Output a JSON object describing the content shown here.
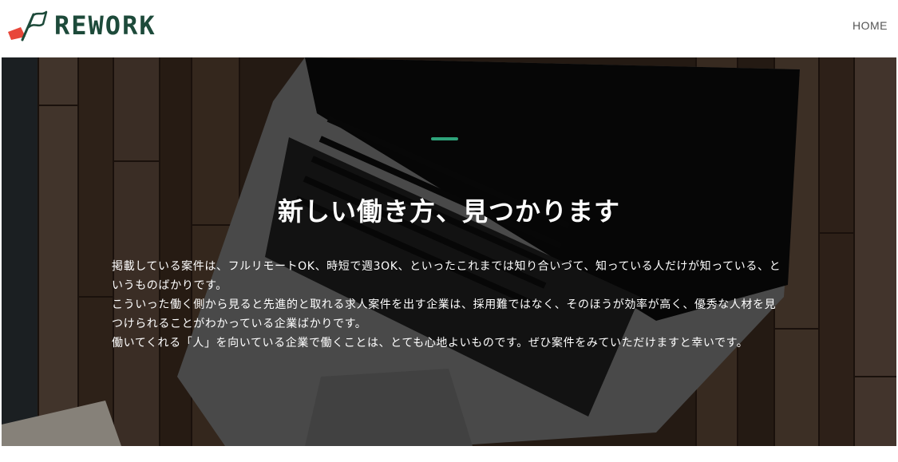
{
  "header": {
    "logo_text": "REWORK",
    "nav_home": "HOME"
  },
  "hero": {
    "title": "新しい働き方、見つかります",
    "paragraphs": [
      "掲載している案件は、フルリモートOK、時短で週3OK、といったこれまでは知り合いづて、知っている人だけが知っている、というものばかりです。",
      "こういった働く側から見ると先進的と取れる求人案件を出す企業は、採用難ではなく、そのほうが効率が高く、優秀な人材を見つけられることがわかっている企業ばかりです。",
      "働いてくれる「人」を向いている企業で働くことは、とても心地よいものです。ぜひ案件をみていただけますと幸いです。"
    ]
  },
  "colors": {
    "brand_green": "#1d4a3a",
    "accent_green": "#2ea37a",
    "logo_red": "#e8473a"
  },
  "icons": [
    "flag-logo-icon"
  ]
}
